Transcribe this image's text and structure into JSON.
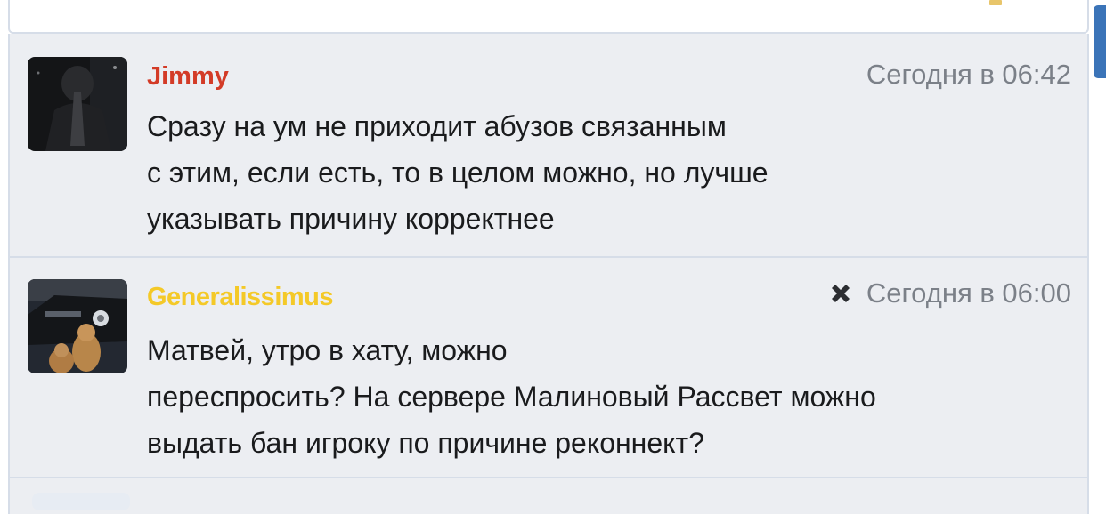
{
  "posts": [
    {
      "author": "Jimmy",
      "author_color": "#d33b27",
      "time": "Сегодня в 06:42",
      "lines": [
        "Сразу на ум не приходит абузов связанным",
        "с этим, если есть, то в целом можно, но лучше",
        "указывать причину корректнее"
      ],
      "avatar": "photo-person-dark"
    },
    {
      "author": "Generalissimus",
      "author_color": "#f4c928",
      "time": "Сегодня в 06:00",
      "close_icon": "close-icon",
      "lines": [
        "Матвей, утро в хату, можно",
        "переспросить? На сервере Малиновый Рассвет можно",
        "выдать бан игроку по причине реконнект?"
      ],
      "avatar": "photo-dogs-car"
    }
  ],
  "colors": {
    "feed_bg": "#eceef2",
    "border": "#d6dde8",
    "text": "#1a1b1d",
    "meta": "#7b8088",
    "scroll_thumb": "#3b74b8"
  }
}
